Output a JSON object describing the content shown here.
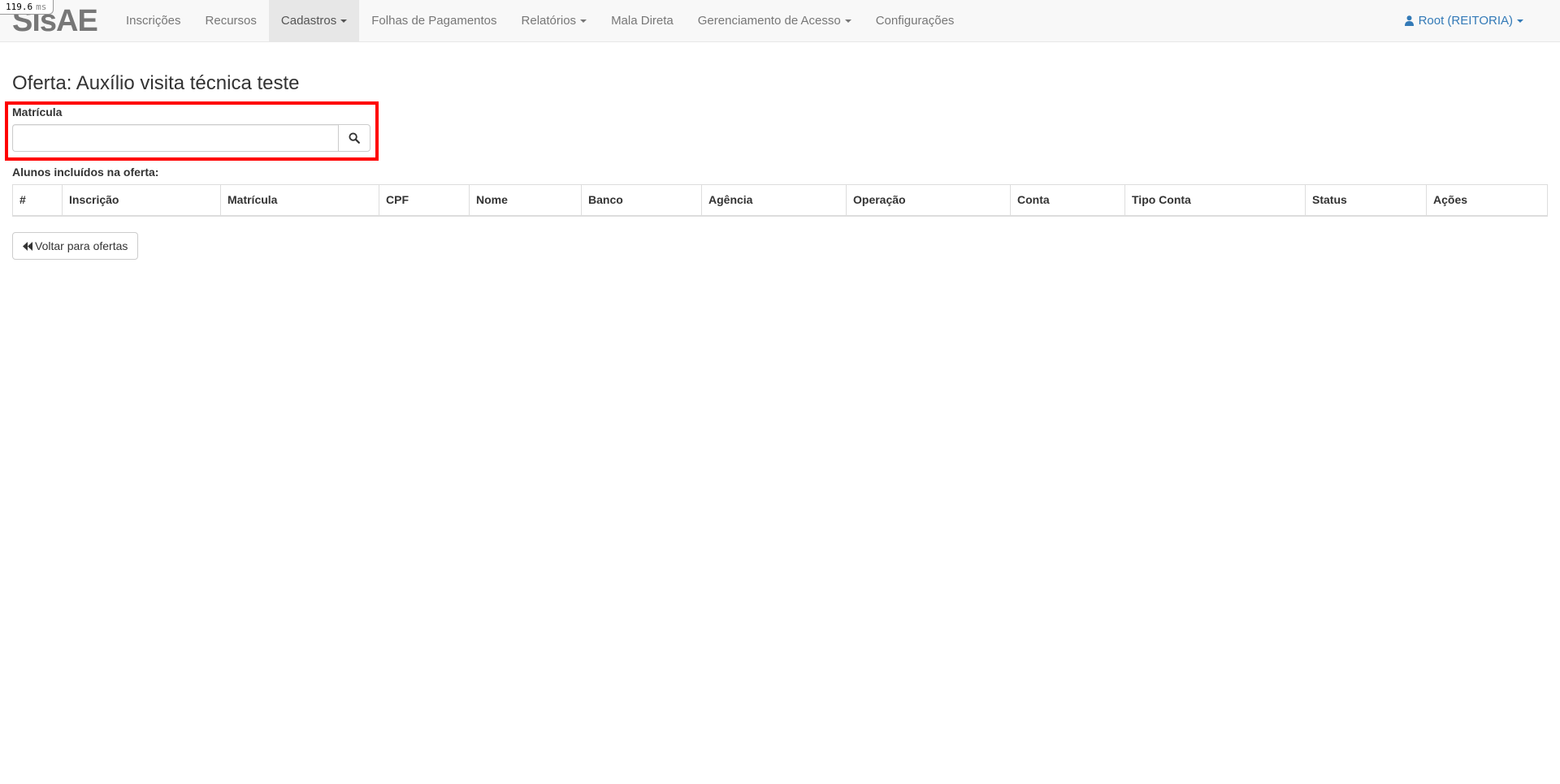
{
  "perf_badge": {
    "value": "119.6",
    "unit": "ms"
  },
  "navbar": {
    "brand": "SisAE",
    "items": [
      {
        "label": "Inscrições",
        "dropdown": false,
        "active": false
      },
      {
        "label": "Recursos",
        "dropdown": false,
        "active": false
      },
      {
        "label": "Cadastros",
        "dropdown": true,
        "active": true
      },
      {
        "label": "Folhas de Pagamentos",
        "dropdown": false,
        "active": false
      },
      {
        "label": "Relatórios",
        "dropdown": true,
        "active": false
      },
      {
        "label": "Mala Direta",
        "dropdown": false,
        "active": false
      },
      {
        "label": "Gerenciamento de Acesso",
        "dropdown": true,
        "active": false
      },
      {
        "label": "Configurações",
        "dropdown": false,
        "active": false
      }
    ],
    "user": {
      "label": "Root (REITORIA)",
      "icon": "user-icon"
    }
  },
  "page": {
    "title": "Oferta: Auxílio visita técnica teste",
    "matricula_label": "Matrícula",
    "matricula_value": "",
    "search_icon": "search-icon",
    "table_caption": "Alunos incluídos na oferta:",
    "back_button": {
      "label": "Voltar para ofertas",
      "icon": "backward-icon"
    }
  },
  "table": {
    "columns": [
      "#",
      "Inscrição",
      "Matrícula",
      "CPF",
      "Nome",
      "Banco",
      "Agência",
      "Operação",
      "Conta",
      "Tipo Conta",
      "Status",
      "Ações"
    ],
    "rows": []
  },
  "colors": {
    "navbar_bg": "#f8f8f8",
    "active_nav_bg": "#e7e7e7",
    "link": "#337ab7",
    "highlight": "#ff0000"
  }
}
